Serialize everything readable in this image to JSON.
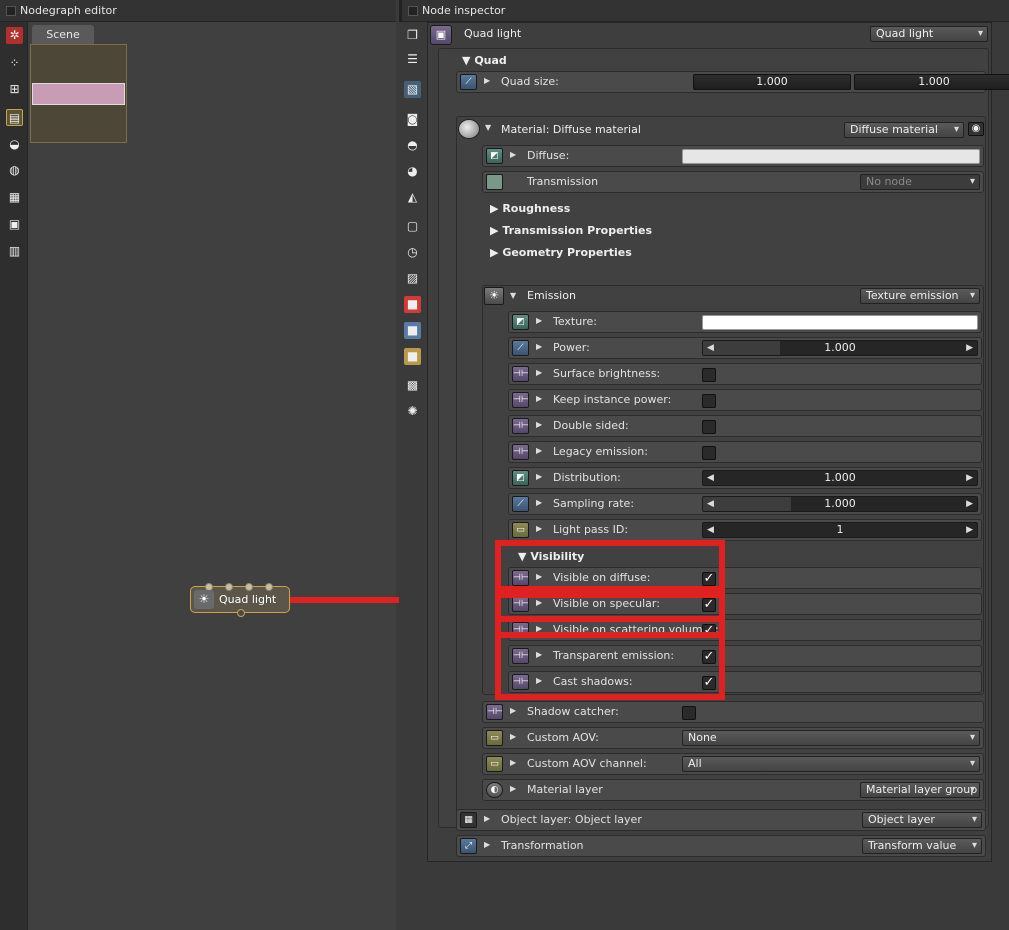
{
  "nodegraph": {
    "title": "Nodegraph editor",
    "tab": "Scene",
    "node_label": "Quad light"
  },
  "inspector": {
    "title": "Node inspector",
    "node_name": "Quad light",
    "node_type": "Quad light",
    "quad_section": "Quad",
    "quad_size": {
      "label": "Quad size:",
      "x": "1.000",
      "y": "1.000"
    },
    "material": {
      "label": "Material: Diffuse material",
      "type": "Diffuse material"
    },
    "diffuse": {
      "label": "Diffuse:",
      "color": "#e6e6e6"
    },
    "transmission": {
      "label": "Transmission",
      "value": "No node"
    },
    "collapsed_sections": [
      "Roughness",
      "Transmission Properties",
      "Geometry Properties"
    ],
    "emission": {
      "label": "Emission",
      "type": "Texture emission",
      "texture": {
        "label": "Texture:"
      },
      "power": {
        "label": "Power:",
        "value": "1.000"
      },
      "surface_brightness": {
        "label": "Surface brightness:",
        "checked": false
      },
      "keep_instance_power": {
        "label": "Keep instance power:",
        "checked": false
      },
      "double_sided": {
        "label": "Double sided:",
        "checked": false
      },
      "legacy_emission": {
        "label": "Legacy emission:",
        "checked": false
      },
      "distribution": {
        "label": "Distribution:",
        "value": "1.000"
      },
      "sampling_rate": {
        "label": "Sampling rate:",
        "value": "1.000"
      },
      "light_pass_id": {
        "label": "Light pass ID:",
        "value": "1"
      }
    },
    "visibility": {
      "title": "Visibility",
      "items": [
        {
          "label": "Visible on diffuse:",
          "checked": true
        },
        {
          "label": "Visible on specular:",
          "checked": true
        },
        {
          "label": "Visible on scattering volumes:",
          "checked": true
        },
        {
          "label": "Transparent emission:",
          "checked": true
        },
        {
          "label": "Cast shadows:",
          "checked": true
        }
      ]
    },
    "shadow_catcher": {
      "label": "Shadow catcher:",
      "checked": false
    },
    "custom_aov": {
      "label": "Custom AOV:",
      "value": "None"
    },
    "custom_aov_channel": {
      "label": "Custom AOV channel:",
      "value": "All"
    },
    "material_layer": {
      "label": "Material layer",
      "type": "Material layer group"
    },
    "object_layer": {
      "label": "Object layer: Object layer",
      "type": "Object layer"
    },
    "transformation": {
      "label": "Transformation",
      "type": "Transform value"
    },
    "check_glyph": "✓",
    "arrow_right": "▶",
    "arrow_down": "▼",
    "arrow_left": "◀"
  },
  "colors": {
    "highlight": "#e12020",
    "node_border": "#c9a24a"
  }
}
